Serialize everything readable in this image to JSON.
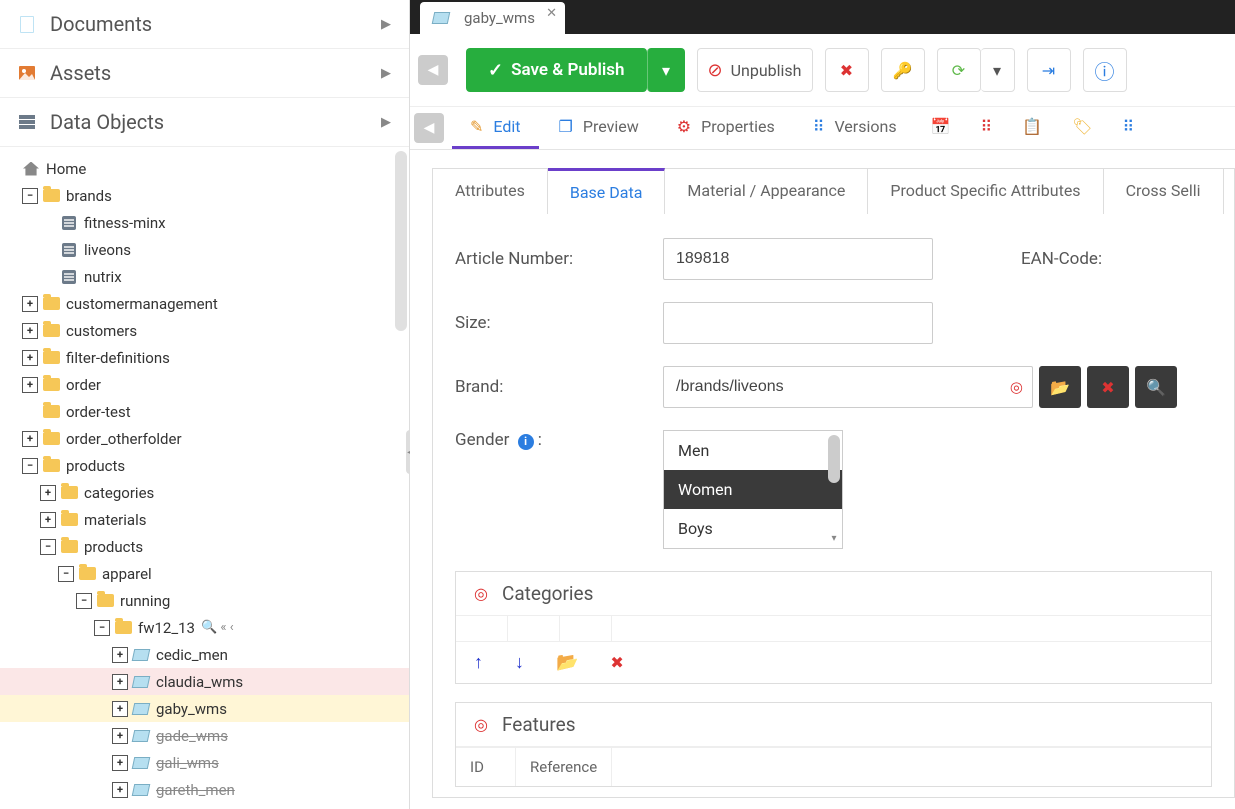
{
  "sidebar": {
    "accordion": [
      {
        "label": "Documents"
      },
      {
        "label": "Assets"
      },
      {
        "label": "Data Objects"
      }
    ],
    "root": "Home",
    "tree": [
      {
        "label": "brands",
        "type": "folder",
        "depth": 1,
        "toggle": "-",
        "children": [
          {
            "label": "fitness-minx",
            "type": "db",
            "depth": 2
          },
          {
            "label": "liveons",
            "type": "db",
            "depth": 2
          },
          {
            "label": "nutrix",
            "type": "db",
            "depth": 2
          }
        ]
      },
      {
        "label": "customermanagement",
        "type": "folder",
        "depth": 1,
        "toggle": "+"
      },
      {
        "label": "customers",
        "type": "folder",
        "depth": 1,
        "toggle": "+"
      },
      {
        "label": "filter-definitions",
        "type": "folder",
        "depth": 1,
        "toggle": "+"
      },
      {
        "label": "order",
        "type": "folder",
        "depth": 1,
        "toggle": "+"
      },
      {
        "label": "order-test",
        "type": "folder",
        "depth": 1,
        "toggle": ""
      },
      {
        "label": "order_otherfolder",
        "type": "folder",
        "depth": 1,
        "toggle": "+"
      },
      {
        "label": "products",
        "type": "folder",
        "depth": 1,
        "toggle": "-",
        "children": [
          {
            "label": "categories",
            "type": "folder",
            "depth": 2,
            "toggle": "+"
          },
          {
            "label": "materials",
            "type": "folder",
            "depth": 2,
            "toggle": "+"
          },
          {
            "label": "products",
            "type": "folder",
            "depth": 2,
            "toggle": "-",
            "children": [
              {
                "label": "apparel",
                "type": "folder",
                "depth": 3,
                "toggle": "-",
                "children": [
                  {
                    "label": "running",
                    "type": "folder",
                    "depth": 4,
                    "toggle": "-",
                    "children": [
                      {
                        "label": "fw12_13",
                        "type": "folder",
                        "depth": 5,
                        "toggle": "-",
                        "extra": true,
                        "children": [
                          {
                            "label": "cedic_men",
                            "type": "tag",
                            "depth": 6,
                            "toggle": "+"
                          },
                          {
                            "label": "claudia_wms",
                            "type": "tag",
                            "depth": 6,
                            "toggle": "+",
                            "hl": "red"
                          },
                          {
                            "label": "gaby_wms",
                            "type": "tag",
                            "depth": 6,
                            "toggle": "+",
                            "hl": "yel"
                          },
                          {
                            "label": "gade_wms",
                            "type": "tag",
                            "depth": 6,
                            "toggle": "+",
                            "strike": true
                          },
                          {
                            "label": "gali_wms",
                            "type": "tag",
                            "depth": 6,
                            "toggle": "+",
                            "strike": true
                          },
                          {
                            "label": "gareth_men",
                            "type": "tag",
                            "depth": 6,
                            "toggle": "+",
                            "strike": true
                          }
                        ]
                      }
                    ]
                  }
                ]
              }
            ]
          }
        ]
      }
    ]
  },
  "tab": {
    "label": "gaby_wms"
  },
  "toolbar": {
    "save_publish": "Save & Publish",
    "unpublish": "Unpublish"
  },
  "viewtabs": {
    "edit": "Edit",
    "preview": "Preview",
    "properties": "Properties",
    "versions": "Versions"
  },
  "subtabs": [
    "Attributes",
    "Base Data",
    "Material / Appearance",
    "Product Specific Attributes",
    "Cross Selli"
  ],
  "subtab_active": "Base Data",
  "form": {
    "article_label": "Article Number:",
    "article_value": "189818",
    "ean_label": "EAN-Code:",
    "size_label": "Size:",
    "size_value": "",
    "brand_label": "Brand:",
    "brand_value": "/brands/liveons",
    "gender_label": "Gender",
    "gender_options": [
      "Men",
      "Women",
      "Boys"
    ],
    "gender_selected": "Women"
  },
  "sections": {
    "categories": "Categories",
    "features": "Features",
    "feat_cols": [
      "ID",
      "Reference"
    ]
  }
}
